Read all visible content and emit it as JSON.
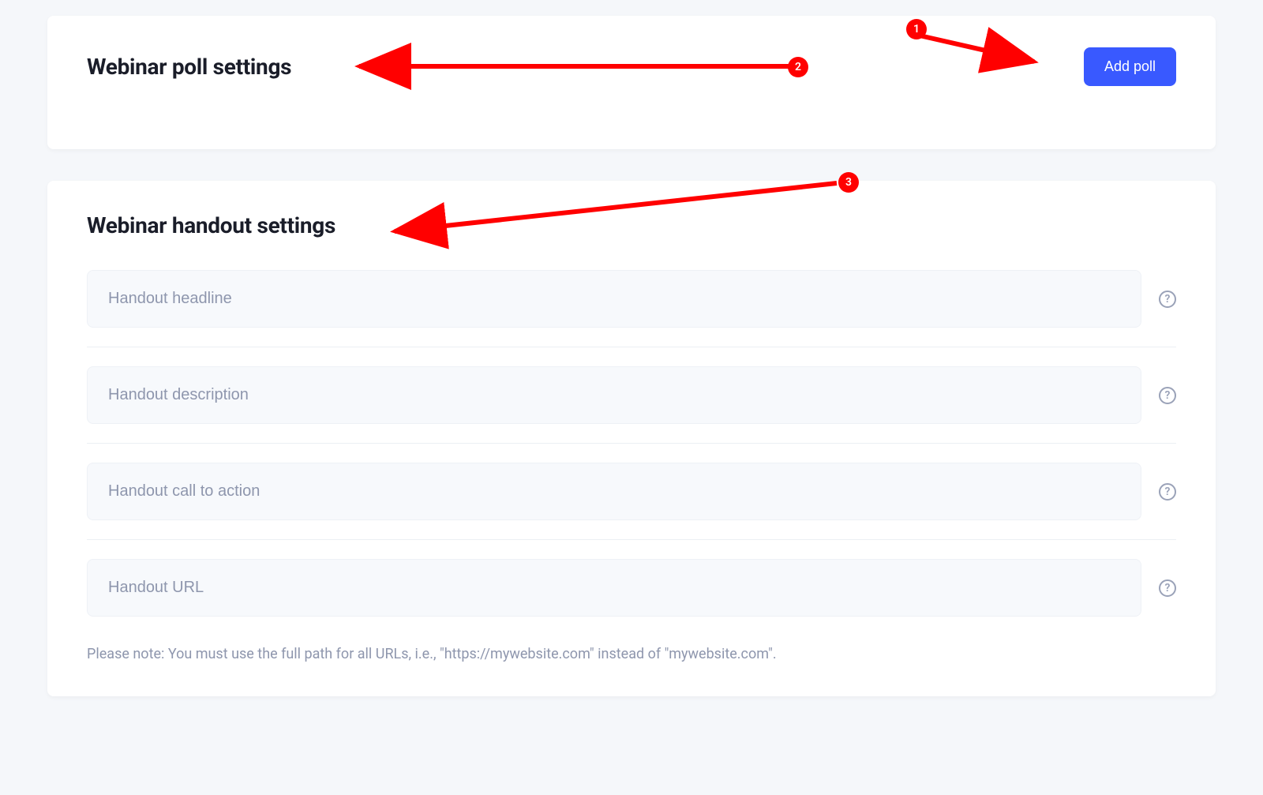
{
  "poll_section": {
    "title": "Webinar poll settings",
    "add_button_label": "Add poll"
  },
  "handout_section": {
    "title": "Webinar handout settings",
    "fields": [
      {
        "placeholder": "Handout headline"
      },
      {
        "placeholder": "Handout description"
      },
      {
        "placeholder": "Handout call to action"
      },
      {
        "placeholder": "Handout URL"
      }
    ],
    "note": "Please note: You must use the full path for all URLs, i.e., \"https://mywebsite.com\" instead of \"mywebsite.com\"."
  },
  "annotations": {
    "badge1": "1",
    "badge2": "2",
    "badge3": "3"
  },
  "help_glyph": "?"
}
